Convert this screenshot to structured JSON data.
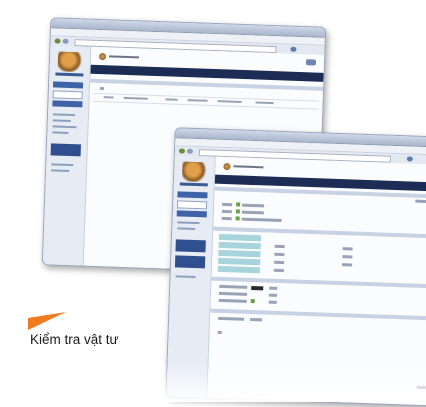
{
  "caption": {
    "text": "Kiểm tra vật tư"
  },
  "colors": {
    "accent_orange": "#f07a20",
    "header_dark": "#1c2c55",
    "sidebar_blue": "#3e63a6",
    "highlight_teal": "#a8d4dc",
    "check_green": "#6aa04a"
  },
  "back_window": {
    "icons": [
      "app-logo-icon",
      "user-avatar-icon",
      "search-icon"
    ]
  },
  "front_window": {
    "icons": [
      "app-logo-icon",
      "user-avatar-icon",
      "check-icon",
      "settings-icon"
    ]
  }
}
